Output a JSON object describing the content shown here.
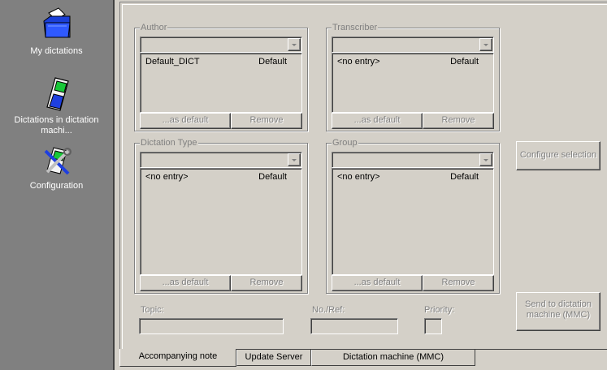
{
  "sidebar": {
    "items": [
      {
        "label": "My dictations",
        "icon": "folder-icon",
        "selected": false
      },
      {
        "label": "Dictations in dictation machi...",
        "icon": "dictation-device-icon",
        "selected": false
      },
      {
        "label": "Configuration",
        "icon": "configuration-tools-icon",
        "selected": true
      }
    ]
  },
  "author": {
    "title": "Author",
    "combo_value": "",
    "rows": [
      {
        "name": "Default_DICT",
        "default": "Default"
      }
    ],
    "as_default_label": "...as default",
    "remove_label": "Remove"
  },
  "transcriber": {
    "title": "Transcriber",
    "combo_value": "",
    "rows": [
      {
        "name": "<no entry>",
        "default": "Default"
      }
    ],
    "as_default_label": "...as default",
    "remove_label": "Remove"
  },
  "dictation_type": {
    "title": "Dictation Type",
    "combo_value": "",
    "rows": [
      {
        "name": "<no entry>",
        "default": "Default"
      }
    ],
    "as_default_label": "...as default",
    "remove_label": "Remove"
  },
  "group": {
    "title": "Group",
    "combo_value": "",
    "rows": [
      {
        "name": "<no entry>",
        "default": "Default"
      }
    ],
    "as_default_label": "...as default",
    "remove_label": "Remove"
  },
  "configure_selection_label": "Configure selection",
  "send_to_machine_label": "Send to dictation machine (MMC)",
  "fields": {
    "topic_label": "Topic:",
    "topic_value": "",
    "noref_label": "No./Ref:",
    "noref_value": "",
    "priority_label": "Priority:",
    "priority_value": ""
  },
  "tabs": [
    {
      "label": "Accompanying note",
      "active": true
    },
    {
      "label": "Update Server",
      "active": false
    },
    {
      "label": "Dictation machine (MMC)",
      "active": false
    }
  ]
}
